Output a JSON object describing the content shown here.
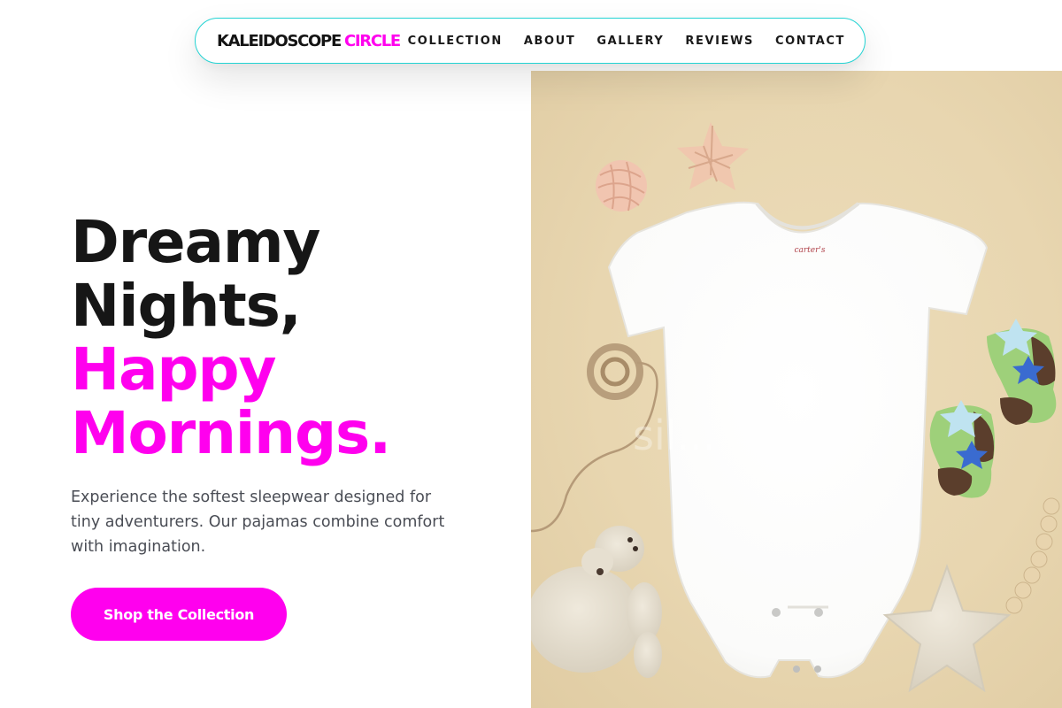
{
  "brand": {
    "word1": "KALEIDOSCOPE",
    "word2": "CIRCLE",
    "accent_color": "#ff00ee",
    "border_color": "#22d3d3"
  },
  "nav": {
    "items": [
      {
        "label": "COLLECTION"
      },
      {
        "label": "ABOUT"
      },
      {
        "label": "GALLERY"
      },
      {
        "label": "REVIEWS"
      },
      {
        "label": "CONTACT"
      }
    ]
  },
  "hero": {
    "headline_lines": [
      {
        "text": "Dreamy",
        "color": "#161616"
      },
      {
        "text": "Nights,",
        "color": "#161616"
      },
      {
        "text": "Happy",
        "color": "#ff00ee"
      },
      {
        "text": "Mornings.",
        "color": "#ff00ee"
      }
    ],
    "description": "Experience the softest sleepwear designed for tiny adventurers. Our pajamas combine comfort with imagination.",
    "cta_label": "Shop the Collection"
  },
  "photo": {
    "garment_label": "carter's",
    "watermark": "sil...",
    "background_color": "#e8d6b0"
  }
}
